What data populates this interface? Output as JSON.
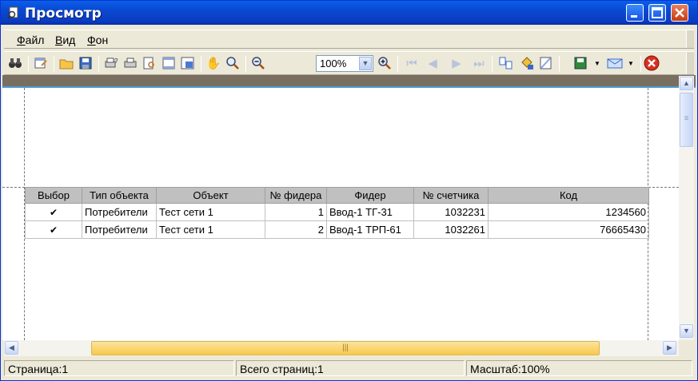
{
  "window": {
    "title": "Просмотр",
    "title_icon": "preview-document-icon"
  },
  "menu": [
    {
      "label": "Файл",
      "underline": "Ф",
      "rest": "айл"
    },
    {
      "label": "Вид",
      "underline": "В",
      "rest": "ид"
    },
    {
      "label": "Фон",
      "underline": "Ф",
      "rest": "он"
    }
  ],
  "toolbar": {
    "zoom_value": "100%",
    "icons": [
      "binoculars-icon",
      "page-setup-icon",
      "open-folder-icon",
      "save-disk-icon",
      "print-setup-icon",
      "print-icon",
      "print-preview-icon",
      "page-header-icon",
      "page-fit-icon",
      "hand-tool-icon",
      "magnifier-icon",
      "zoom-out-icon",
      "zoom-in-icon",
      "first-page-icon",
      "prev-page-icon",
      "next-page-icon",
      "last-page-icon",
      "multi-page-icon",
      "background-fill-icon",
      "watermark-icon",
      "export-icon",
      "email-icon",
      "close-preview-icon"
    ]
  },
  "table": {
    "headers": [
      "Выбор",
      "Тип объекта",
      "Объект",
      "№ фидера",
      "Фидер",
      "№ счетчика",
      "Код"
    ],
    "rows": [
      {
        "checked": "✔",
        "type": "Потребители",
        "object": "Тест сети 1",
        "feeder_no": "1",
        "feeder": "Ввод-1 ТГ-31",
        "meter_no": "1032231",
        "code": "1234560"
      },
      {
        "checked": "✔",
        "type": "Потребители",
        "object": "Тест сети 1",
        "feeder_no": "2",
        "feeder": "Ввод-1 ТРП-61",
        "meter_no": "1032261",
        "code": "76665430"
      }
    ]
  },
  "status": {
    "page": "Страница:1",
    "total_pages": "Всего страниц:1",
    "zoom": "Масштаб:100%"
  },
  "colors": {
    "title_bar": "#0A48D0",
    "close_button": "#C73A10",
    "scroll_thumb": "#F8C84C",
    "header_cell": "#C0C0C0"
  }
}
